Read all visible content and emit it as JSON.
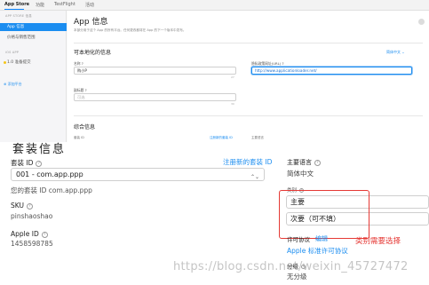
{
  "top_tabs": [
    "App Store",
    "功能",
    "TestFlight",
    "活动"
  ],
  "sidebar": {
    "section1_head": "APP STORE 信息",
    "items": [
      {
        "label": "App 信息",
        "selected": true
      },
      {
        "label": "价格与销售范围",
        "selected": false
      }
    ],
    "section2_head": "iOS APP",
    "prepare_item": "1.0 准备提交",
    "add_platform": "⊕ 添加平台"
  },
  "main": {
    "title": "App 信息",
    "subtitle": "本部分用于这个 App 的所有平台。任何更改都将在 App 的下一个版本中发布。",
    "localizable_title": "可本地化的信息",
    "localization_link": "简体中文 ⌄",
    "name_label": "名称 ?",
    "name_value": "购小P",
    "name_counter": "27",
    "privacy_label": "隐私政策网址(URL) ?",
    "privacy_value": "http://www.applicationloader.net/",
    "subtitle_label": "副标题 ?",
    "subtitle_placeholder": "可选",
    "subtitle_counter": "30",
    "general_title": "综合信息",
    "bundle_mini_label": "套装 ID",
    "register_mini": "注册新的套装 ID",
    "lang_mini_label": "主要语言"
  },
  "detail": {
    "bundle_label": "套装 ID",
    "register_link": "注册新的套装 ID",
    "bundle_selected": "001 - com.app.ppp",
    "bundle_note": "您的套装 ID com.app.ppp",
    "sku_label": "SKU",
    "sku_value": "pinshaoshao",
    "apple_id_label": "Apple ID",
    "apple_id_value": "1458598785",
    "primary_lang_label": "主要语言",
    "primary_lang_value": "简体中文",
    "category_label": "类别",
    "category_primary": "主要",
    "category_secondary": "次要（可不填）",
    "license_label": "许可协议",
    "license_edit": "编辑",
    "license_value": "Apple 标准许可协议",
    "rating_label": "分级",
    "rating_value": "无分级",
    "annotation": "类别需要选择",
    "cut_heading": "套装信息",
    "help_glyph": "?",
    "chevron": "⌃⌄"
  },
  "watermark": "https://blog.csdn.net/weixin_45727472",
  "colors": {
    "link": "#1b8df0",
    "selected": "#1b8df0",
    "annotation": "#e53935"
  }
}
